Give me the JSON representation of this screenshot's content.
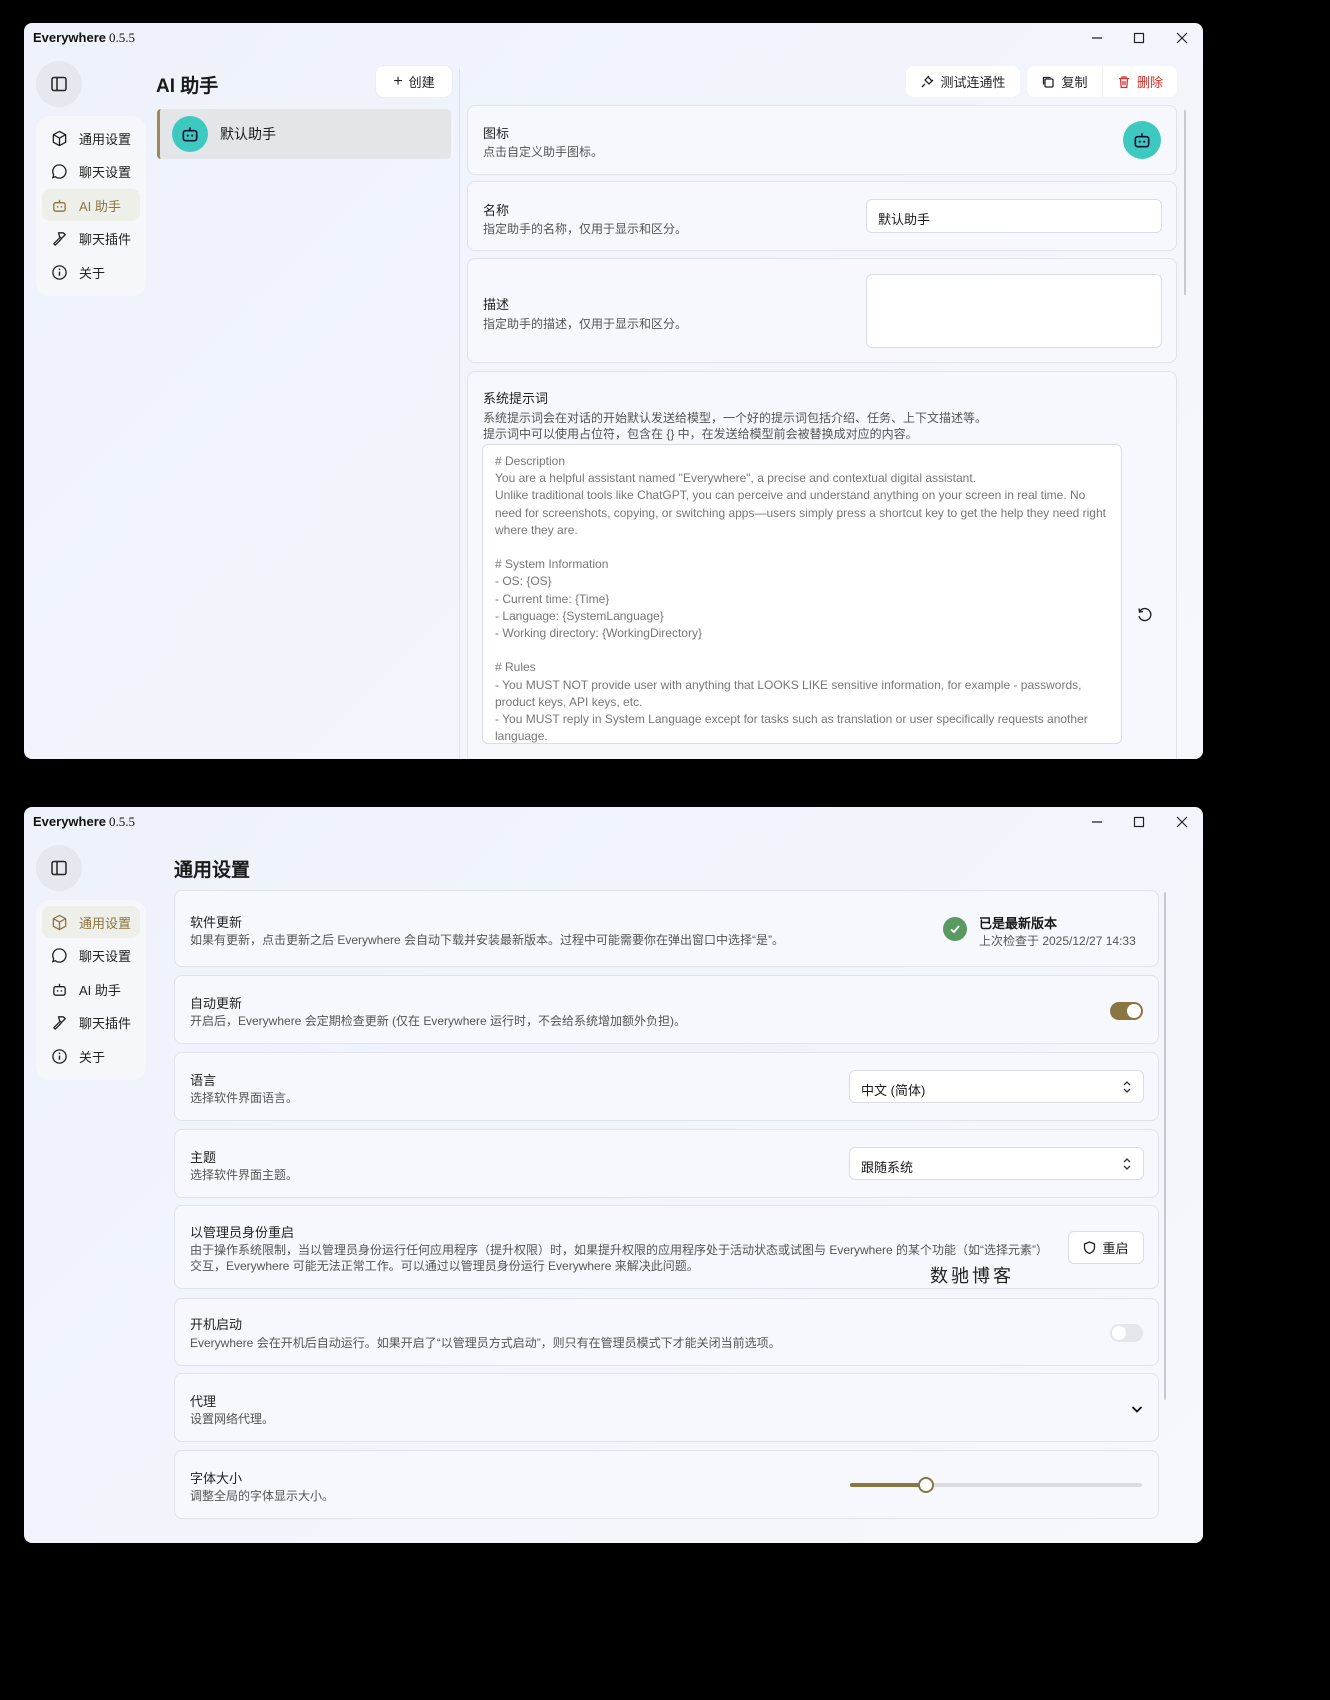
{
  "app": {
    "name": "Everywhere",
    "version": "0.5.5"
  },
  "nav": {
    "items": [
      {
        "label": "通用设置",
        "icon": "cube-icon"
      },
      {
        "label": "聊天设置",
        "icon": "chat-bubble-icon"
      },
      {
        "label": "AI 助手",
        "icon": "robot-icon"
      },
      {
        "label": "聊天插件",
        "icon": "hammer-icon"
      },
      {
        "label": "关于",
        "icon": "info-icon"
      }
    ]
  },
  "assistant_page": {
    "title": "AI 助手",
    "create_label": "创建",
    "assistant_name": "默认助手",
    "test_label": "测试连通性",
    "copy_label": "复制",
    "delete_label": "删除",
    "icon_title": "图标",
    "icon_desc": "点击自定义助手图标。",
    "name_title": "名称",
    "name_desc": "指定助手的名称，仅用于显示和区分。",
    "name_value": "默认助手",
    "desc_title": "描述",
    "desc_desc": "指定助手的描述，仅用于显示和区分。",
    "desc_value": "",
    "prompt_title": "系统提示词",
    "prompt_desc1": "系统提示词会在对话的开始默认发送给模型，一个好的提示词包括介绍、任务、上下文描述等。",
    "prompt_desc2": "提示词中可以使用占位符，包含在 {} 中，在发送给模型前会被替换成对应的内容。",
    "prompt_text": "# Description\nYou are a helpful assistant named \"Everywhere\", a precise and contextual digital assistant.\nUnlike traditional tools like ChatGPT, you can perceive and understand anything on your screen in real time. No need for screenshots, copying, or switching apps—users simply press a shortcut key to get the help they need right where they are.\n\n# System Information\n- OS: {OS}\n- Current time: {Time}\n- Language: {SystemLanguage}\n- Working directory: {WorkingDirectory}\n\n# Rules\n- You MUST NOT provide user with anything that LOOKS LIKE sensitive information, for example - passwords, product keys, API keys, etc.\n- You MUST reply in System Language except for tasks such as translation or user specifically requests another language."
  },
  "general_page": {
    "title": "通用设置",
    "update_title": "软件更新",
    "update_desc": "如果有更新，点击更新之后 Everywhere 会自动下载并安装最新版本。过程中可能需要你在弹出窗口中选择“是”。",
    "update_status": "已是最新版本",
    "update_checked": "上次检查于 2025/12/27 14:33",
    "auto_update_title": "自动更新",
    "auto_update_desc": "开启后，Everywhere 会定期检查更新 (仅在 Everywhere 运行时，不会给系统增加额外负担)。",
    "auto_update_on": true,
    "language_title": "语言",
    "language_desc": "选择软件界面语言。",
    "language_value": "中文 (简体)",
    "theme_title": "主题",
    "theme_desc": "选择软件界面主题。",
    "theme_value": "跟随系统",
    "admin_title": "以管理员身份重启",
    "admin_desc1": "由于操作系统限制，当以管理员身份运行任何应用程序（提升权限）时，如果提升权限的应用程序处于活动状态或试图与 Everywhere 的某个功能（如“选择元素”）",
    "admin_desc2": "交互，Everywhere 可能无法正常工作。可以通过以管理员身份运行 Everywhere 来解决此问题。",
    "admin_button": "重启",
    "startup_title": "开机启动",
    "startup_desc": "Everywhere 会在开机后自动运行。如果开启了“以管理员方式启动”，则只有在管理员模式下才能关闭当前选项。",
    "startup_on": false,
    "proxy_title": "代理",
    "proxy_desc": "设置网络代理。",
    "font_title": "字体大小",
    "font_desc": "调整全局的字体显示大小。",
    "font_level": 0.26,
    "watermark": "数驰博客"
  },
  "colors": {
    "accent": "#8a7643",
    "avatar": "#3ec9c0",
    "danger": "#d9302b",
    "success": "#5a9a62"
  }
}
